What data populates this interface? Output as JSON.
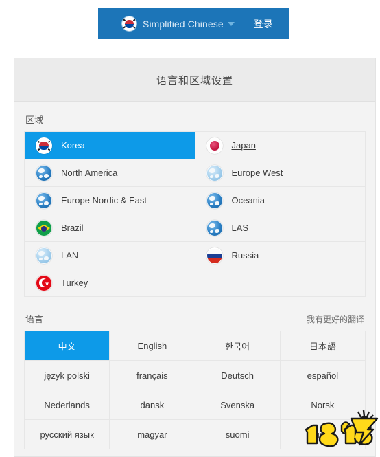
{
  "topbar": {
    "flag_icon": "korea-flag-icon",
    "language_label": "Simplified Chinese",
    "dropdown_icon": "chevron-down-icon",
    "login_label": "登录",
    "background_color": "#1c75b8"
  },
  "panel": {
    "title": "语言和区域设置",
    "accent_color": "#0d9ae8",
    "background_color": "#f3f3f3",
    "header_color": "#ebebeb"
  },
  "region_section": {
    "label": "区域",
    "items": [
      {
        "name": "Korea",
        "icon": "korea-flag-icon",
        "selected": true,
        "underlined": false
      },
      {
        "name": "Japan",
        "icon": "japan-flag-icon",
        "selected": false,
        "underlined": true
      },
      {
        "name": "North America",
        "icon": "globe-icon",
        "selected": false,
        "underlined": false
      },
      {
        "name": "Europe West",
        "icon": "globe-pale-icon",
        "selected": false,
        "underlined": false
      },
      {
        "name": "Europe Nordic & East",
        "icon": "globe-icon",
        "selected": false,
        "underlined": false
      },
      {
        "name": "Oceania",
        "icon": "globe-icon",
        "selected": false,
        "underlined": false
      },
      {
        "name": "Brazil",
        "icon": "brazil-flag-icon",
        "selected": false,
        "underlined": false
      },
      {
        "name": "LAS",
        "icon": "globe-icon",
        "selected": false,
        "underlined": false
      },
      {
        "name": "LAN",
        "icon": "globe-pale-icon",
        "selected": false,
        "underlined": false
      },
      {
        "name": "Russia",
        "icon": "russia-flag-icon",
        "selected": false,
        "underlined": false
      },
      {
        "name": "Turkey",
        "icon": "turkey-flag-icon",
        "selected": false,
        "underlined": false
      },
      {
        "name": "",
        "icon": "",
        "selected": false,
        "underlined": false
      }
    ]
  },
  "language_section": {
    "label": "语言",
    "better_translation_label": "我有更好的翻译",
    "items": [
      {
        "name": "中文",
        "selected": true
      },
      {
        "name": "English",
        "selected": false
      },
      {
        "name": "한국어",
        "selected": false
      },
      {
        "name": "日本語",
        "selected": false
      },
      {
        "name": "język polski",
        "selected": false
      },
      {
        "name": "français",
        "selected": false
      },
      {
        "name": "Deutsch",
        "selected": false
      },
      {
        "name": "español",
        "selected": false
      },
      {
        "name": "Nederlands",
        "selected": false
      },
      {
        "name": "dansk",
        "selected": false
      },
      {
        "name": "Svenska",
        "selected": false
      },
      {
        "name": "Norsk",
        "selected": false
      },
      {
        "name": "русский язык",
        "selected": false
      },
      {
        "name": "magyar",
        "selected": false
      },
      {
        "name": "suomi",
        "selected": false
      },
      {
        "name": "Türkçe",
        "selected": false
      }
    ]
  },
  "watermark": {
    "text": "18183",
    "color": "#ffd91a"
  }
}
